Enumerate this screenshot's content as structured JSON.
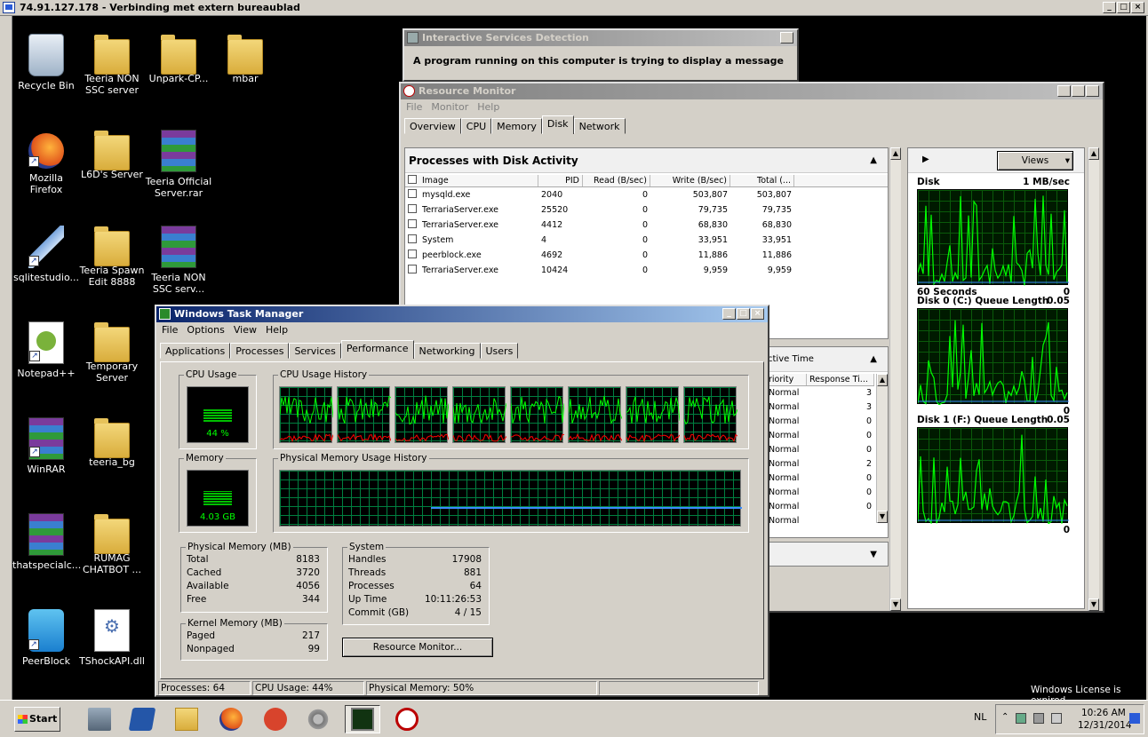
{
  "rdp": {
    "title": "74.91.127.178 - Verbinding met extern bureaublad"
  },
  "desktop": {
    "icons": [
      {
        "label": "Recycle Bin"
      },
      {
        "label": "Teeria NON SSC server"
      },
      {
        "label": "Unpark-CP..."
      },
      {
        "label": "mbar"
      },
      {
        "label": "Mozilla Firefox"
      },
      {
        "label": "L6D's Server"
      },
      {
        "label": "Teeria Official Server.rar"
      },
      {
        "label": "sqlitestudio..."
      },
      {
        "label": "Teeria Spawn Edit 8888"
      },
      {
        "label": "Teeria NON SSC serv..."
      },
      {
        "label": "Notepad++"
      },
      {
        "label": "Temporary Server"
      },
      {
        "label": "WinRAR"
      },
      {
        "label": "teeria_bg"
      },
      {
        "label": "thatspecialc..."
      },
      {
        "label": "RUMAG CHATBOT ..."
      },
      {
        "label": "PeerBlock"
      },
      {
        "label": "TShockAPI.dll"
      }
    ],
    "license": "Windows License is expired"
  },
  "isd": {
    "title": "Interactive Services Detection",
    "message": "A program running on this computer is trying to display a message"
  },
  "resmon": {
    "title": "Resource Monitor",
    "menu": [
      "File",
      "Monitor",
      "Help"
    ],
    "tabs": [
      "Overview",
      "CPU",
      "Memory",
      "Disk",
      "Network"
    ],
    "selected_tab": "Disk",
    "disk_panel": {
      "title": "Processes with Disk Activity",
      "columns": [
        "Image",
        "PID",
        "Read (B/sec)",
        "Write (B/sec)",
        "Total (..."
      ],
      "rows": [
        {
          "image": "mysqld.exe",
          "pid": "2040",
          "read": "0",
          "write": "503,807",
          "total": "503,807"
        },
        {
          "image": "TerrariaServer.exe",
          "pid": "25520",
          "read": "0",
          "write": "79,735",
          "total": "79,735"
        },
        {
          "image": "TerrariaServer.exe",
          "pid": "4412",
          "read": "0",
          "write": "68,830",
          "total": "68,830"
        },
        {
          "image": "System",
          "pid": "4",
          "read": "0",
          "write": "33,951",
          "total": "33,951"
        },
        {
          "image": "peerblock.exe",
          "pid": "4692",
          "read": "0",
          "write": "11,886",
          "total": "11,886"
        },
        {
          "image": "TerrariaServer.exe",
          "pid": "10424",
          "read": "0",
          "write": "9,959",
          "total": "9,959"
        }
      ]
    },
    "activity_panel": {
      "title_fragment": "ctive Time",
      "columns": [
        "riority",
        "Response Ti..."
      ],
      "rows": [
        {
          "priority": "Normal",
          "resp": "3"
        },
        {
          "priority": "Normal",
          "resp": "3"
        },
        {
          "priority": "Normal",
          "resp": "0"
        },
        {
          "priority": "Normal",
          "resp": "0"
        },
        {
          "priority": "Normal",
          "resp": "0"
        },
        {
          "priority": "Normal",
          "resp": "2"
        },
        {
          "priority": "Normal",
          "resp": "0"
        },
        {
          "priority": "Normal",
          "resp": "0"
        },
        {
          "priority": "Normal",
          "resp": "0"
        },
        {
          "priority": "Normal",
          "resp": ""
        }
      ]
    },
    "views_label": "Views",
    "graphs": [
      {
        "title": "Disk",
        "scale": "1 MB/sec",
        "footer_left": "60 Seconds",
        "footer_right": "0"
      },
      {
        "title": "Disk 0 (C:) Queue Length",
        "scale": "0.05",
        "footer_left": "",
        "footer_right": "0"
      },
      {
        "title": "Disk 1 (F:) Queue Length",
        "scale": "0.05",
        "footer_left": "",
        "footer_right": "0"
      }
    ]
  },
  "taskmgr": {
    "title": "Windows Task Manager",
    "menu": [
      "File",
      "Options",
      "View",
      "Help"
    ],
    "tabs": [
      "Applications",
      "Processes",
      "Services",
      "Performance",
      "Networking",
      "Users"
    ],
    "selected_tab": "Performance",
    "cpu_usage_label": "CPU Usage",
    "cpu_usage_value": "44 %",
    "cpu_percent": 44,
    "cpu_history_label": "CPU Usage History",
    "memory_label": "Memory",
    "memory_value": "4.03 GB",
    "memory_percent": 50,
    "phys_history_label": "Physical Memory Usage History",
    "physical": {
      "label": "Physical Memory (MB)",
      "items": [
        {
          "k": "Total",
          "v": "8183"
        },
        {
          "k": "Cached",
          "v": "3720"
        },
        {
          "k": "Available",
          "v": "4056"
        },
        {
          "k": "Free",
          "v": "344"
        }
      ]
    },
    "kernel": {
      "label": "Kernel Memory (MB)",
      "items": [
        {
          "k": "Paged",
          "v": "217"
        },
        {
          "k": "Nonpaged",
          "v": "99"
        }
      ]
    },
    "system": {
      "label": "System",
      "items": [
        {
          "k": "Handles",
          "v": "17908"
        },
        {
          "k": "Threads",
          "v": "881"
        },
        {
          "k": "Processes",
          "v": "64"
        },
        {
          "k": "Up Time",
          "v": "10:11:26:53"
        },
        {
          "k": "Commit (GB)",
          "v": "4 / 15"
        }
      ]
    },
    "resmon_button": "Resource Monitor...",
    "status": {
      "processes": "Processes: 64",
      "cpu": "CPU Usage: 44%",
      "memory": "Physical Memory: 50%"
    }
  },
  "taskbar": {
    "start": "Start",
    "language": "NL",
    "time": "10:26 AM",
    "date": "12/31/2014"
  },
  "colors": {
    "graph_green": "#00ff00",
    "cpu_red": "#ff0000",
    "memory_blue": "#3a8cff",
    "active_title": "#0a246a"
  }
}
